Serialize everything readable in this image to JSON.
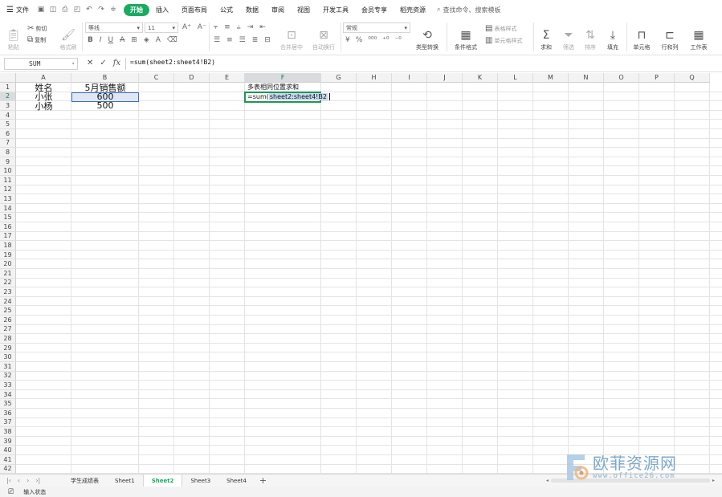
{
  "menubar": {
    "file_label": "文件",
    "tabs": [
      "开始",
      "插入",
      "页面布局",
      "公式",
      "数据",
      "审阅",
      "视图",
      "开发工具",
      "会员专享",
      "稻壳资源"
    ],
    "active_tab": "开始",
    "search_placeholder": "查找命令、搜索模板"
  },
  "ribbon": {
    "paste": "粘贴",
    "cut": "剪切",
    "copy": "复制",
    "format_painter": "格式刷",
    "font_name": "等线",
    "font_size": "11",
    "merge_center": "合并居中",
    "wrap_text": "自动换行",
    "number_format": "常规",
    "type_convert": "类型转换",
    "conditional_format": "条件格式",
    "table_style": "表格样式",
    "cell_style": "单元格样式",
    "sum": "求和",
    "filter": "筛选",
    "sort": "排序",
    "fill": "填充",
    "cells": "单元格",
    "rows_cols": "行和列",
    "worksheet": "工作表"
  },
  "formula_bar": {
    "name_box": "SUM",
    "formula": "=sum(sheet2:sheet4!B2)"
  },
  "grid": {
    "columns": [
      "A",
      "B",
      "C",
      "D",
      "E",
      "F",
      "G",
      "H",
      "I",
      "J",
      "K",
      "L",
      "M",
      "N",
      "O",
      "P",
      "Q"
    ],
    "active_column": "F",
    "active_row": 2,
    "cells": {
      "A1": "姓名",
      "B1": "5月销售额",
      "A2": "小张",
      "B2": "600",
      "A3": "小杨",
      "B3": "500",
      "F1": "多表相同位置求和"
    },
    "edit": {
      "prefix": "=sum(",
      "reference": "sheet2:sheet4!B2"
    }
  },
  "sheets": {
    "tabs": [
      "学生成绩表",
      "Sheet1",
      "Sheet2",
      "Sheet3",
      "Sheet4"
    ],
    "active": "Sheet2"
  },
  "status": {
    "mode": "输入状态"
  },
  "watermark": {
    "title": "欧菲资源网",
    "url": "www.office26.com"
  }
}
